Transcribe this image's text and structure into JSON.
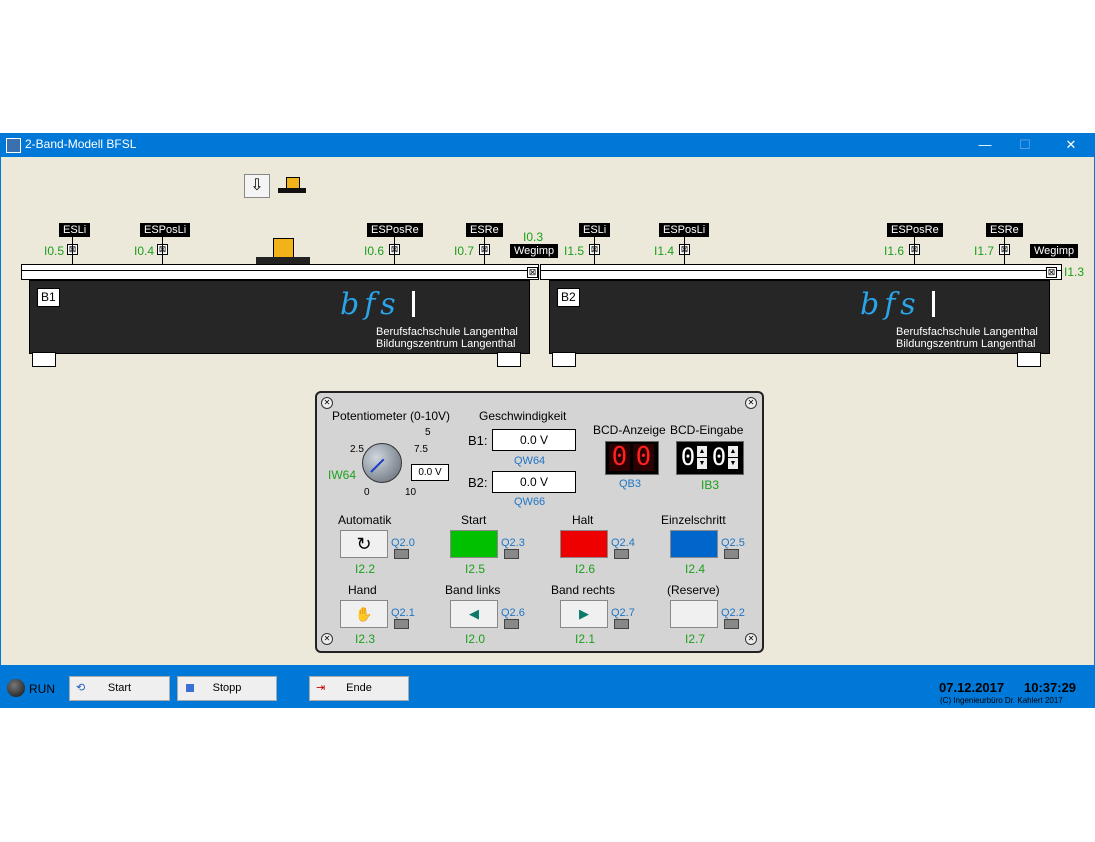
{
  "window": {
    "title": "2-Band-Modell BFSL",
    "min": "—",
    "max": "☐",
    "close": "✕"
  },
  "sensors_b1": [
    {
      "label": "ESLi",
      "io": "I0.5"
    },
    {
      "label": "ESPosLi",
      "io": "I0.4"
    },
    {
      "label": "ESPosRe",
      "io": "I0.6"
    },
    {
      "label": "ESRe",
      "io": "I0.7"
    }
  ],
  "sensors_b2": [
    {
      "label": "ESLi",
      "io": "I1.5"
    },
    {
      "label": "ESPosLi",
      "io": "I1.4"
    },
    {
      "label": "ESPosRe",
      "io": "I1.6"
    },
    {
      "label": "ESRe",
      "io": "I1.7"
    }
  ],
  "wegimp_b1": {
    "label": "Wegimp",
    "io": "I0.3"
  },
  "wegimp_b2": {
    "label": "Wegimp",
    "io": "I1.3"
  },
  "belts": [
    {
      "id": "B1",
      "logo": "bfs",
      "line1": "Berufsfachschule Langenthal",
      "line2": "Bildungszentrum Langenthal"
    },
    {
      "id": "B2",
      "logo": "bfs",
      "line1": "Berufsfachschule Langenthal",
      "line2": "Bildungszentrum Langenthal"
    }
  ],
  "panel": {
    "poti": {
      "title": "Potentiometer (0-10V)",
      "io": "IW64",
      "value": "0.0 V",
      "ticks": {
        "t0": "0",
        "t25": "2.5",
        "t5": "5",
        "t75": "7.5",
        "t10": "10"
      }
    },
    "speed": {
      "title": "Geschwindigkeit",
      "b1_label": "B1:",
      "b1_value": "0.0 V",
      "b1_io": "QW64",
      "b2_label": "B2:",
      "b2_value": "0.0 V",
      "b2_io": "QW66"
    },
    "bcd_out": {
      "title": "BCD-Anzeige",
      "d1": "0",
      "d2": "0",
      "io": "QB3"
    },
    "bcd_in": {
      "title": "BCD-Eingabe",
      "d1": "0",
      "d2": "0",
      "io": "IB3"
    },
    "buttons": [
      {
        "label": "Automatik",
        "q": "Q2.0",
        "i": "I2.2",
        "color": "#f0f0f0",
        "icon": "cycle-icon"
      },
      {
        "label": "Start",
        "q": "Q2.3",
        "i": "I2.5",
        "color": "#00c000",
        "icon": ""
      },
      {
        "label": "Halt",
        "q": "Q2.4",
        "i": "I2.6",
        "color": "#ee0000",
        "icon": ""
      },
      {
        "label": "Einzelschritt",
        "q": "Q2.5",
        "i": "I2.4",
        "color": "#0066cc",
        "icon": ""
      },
      {
        "label": "Hand",
        "q": "Q2.1",
        "i": "I2.3",
        "color": "#f0f0f0",
        "icon": "hand-icon"
      },
      {
        "label": "Band links",
        "q": "Q2.6",
        "i": "I2.0",
        "color": "#f0f0f0",
        "icon": "arrow-left-icon"
      },
      {
        "label": "Band rechts",
        "q": "Q2.7",
        "i": "I2.1",
        "color": "#f0f0f0",
        "icon": "arrow-right-icon"
      },
      {
        "label": "(Reserve)",
        "q": "Q2.2",
        "i": "I2.7",
        "color": "#f0f0f0",
        "icon": ""
      }
    ]
  },
  "taskbar": {
    "run": "RUN",
    "start": "Start",
    "stop": "Stopp",
    "exit": "Ende",
    "date": "07.12.2017",
    "time": "10:37:29",
    "copyright": "(C) Ingenieurbüro Dr. Kahlert 2017"
  }
}
